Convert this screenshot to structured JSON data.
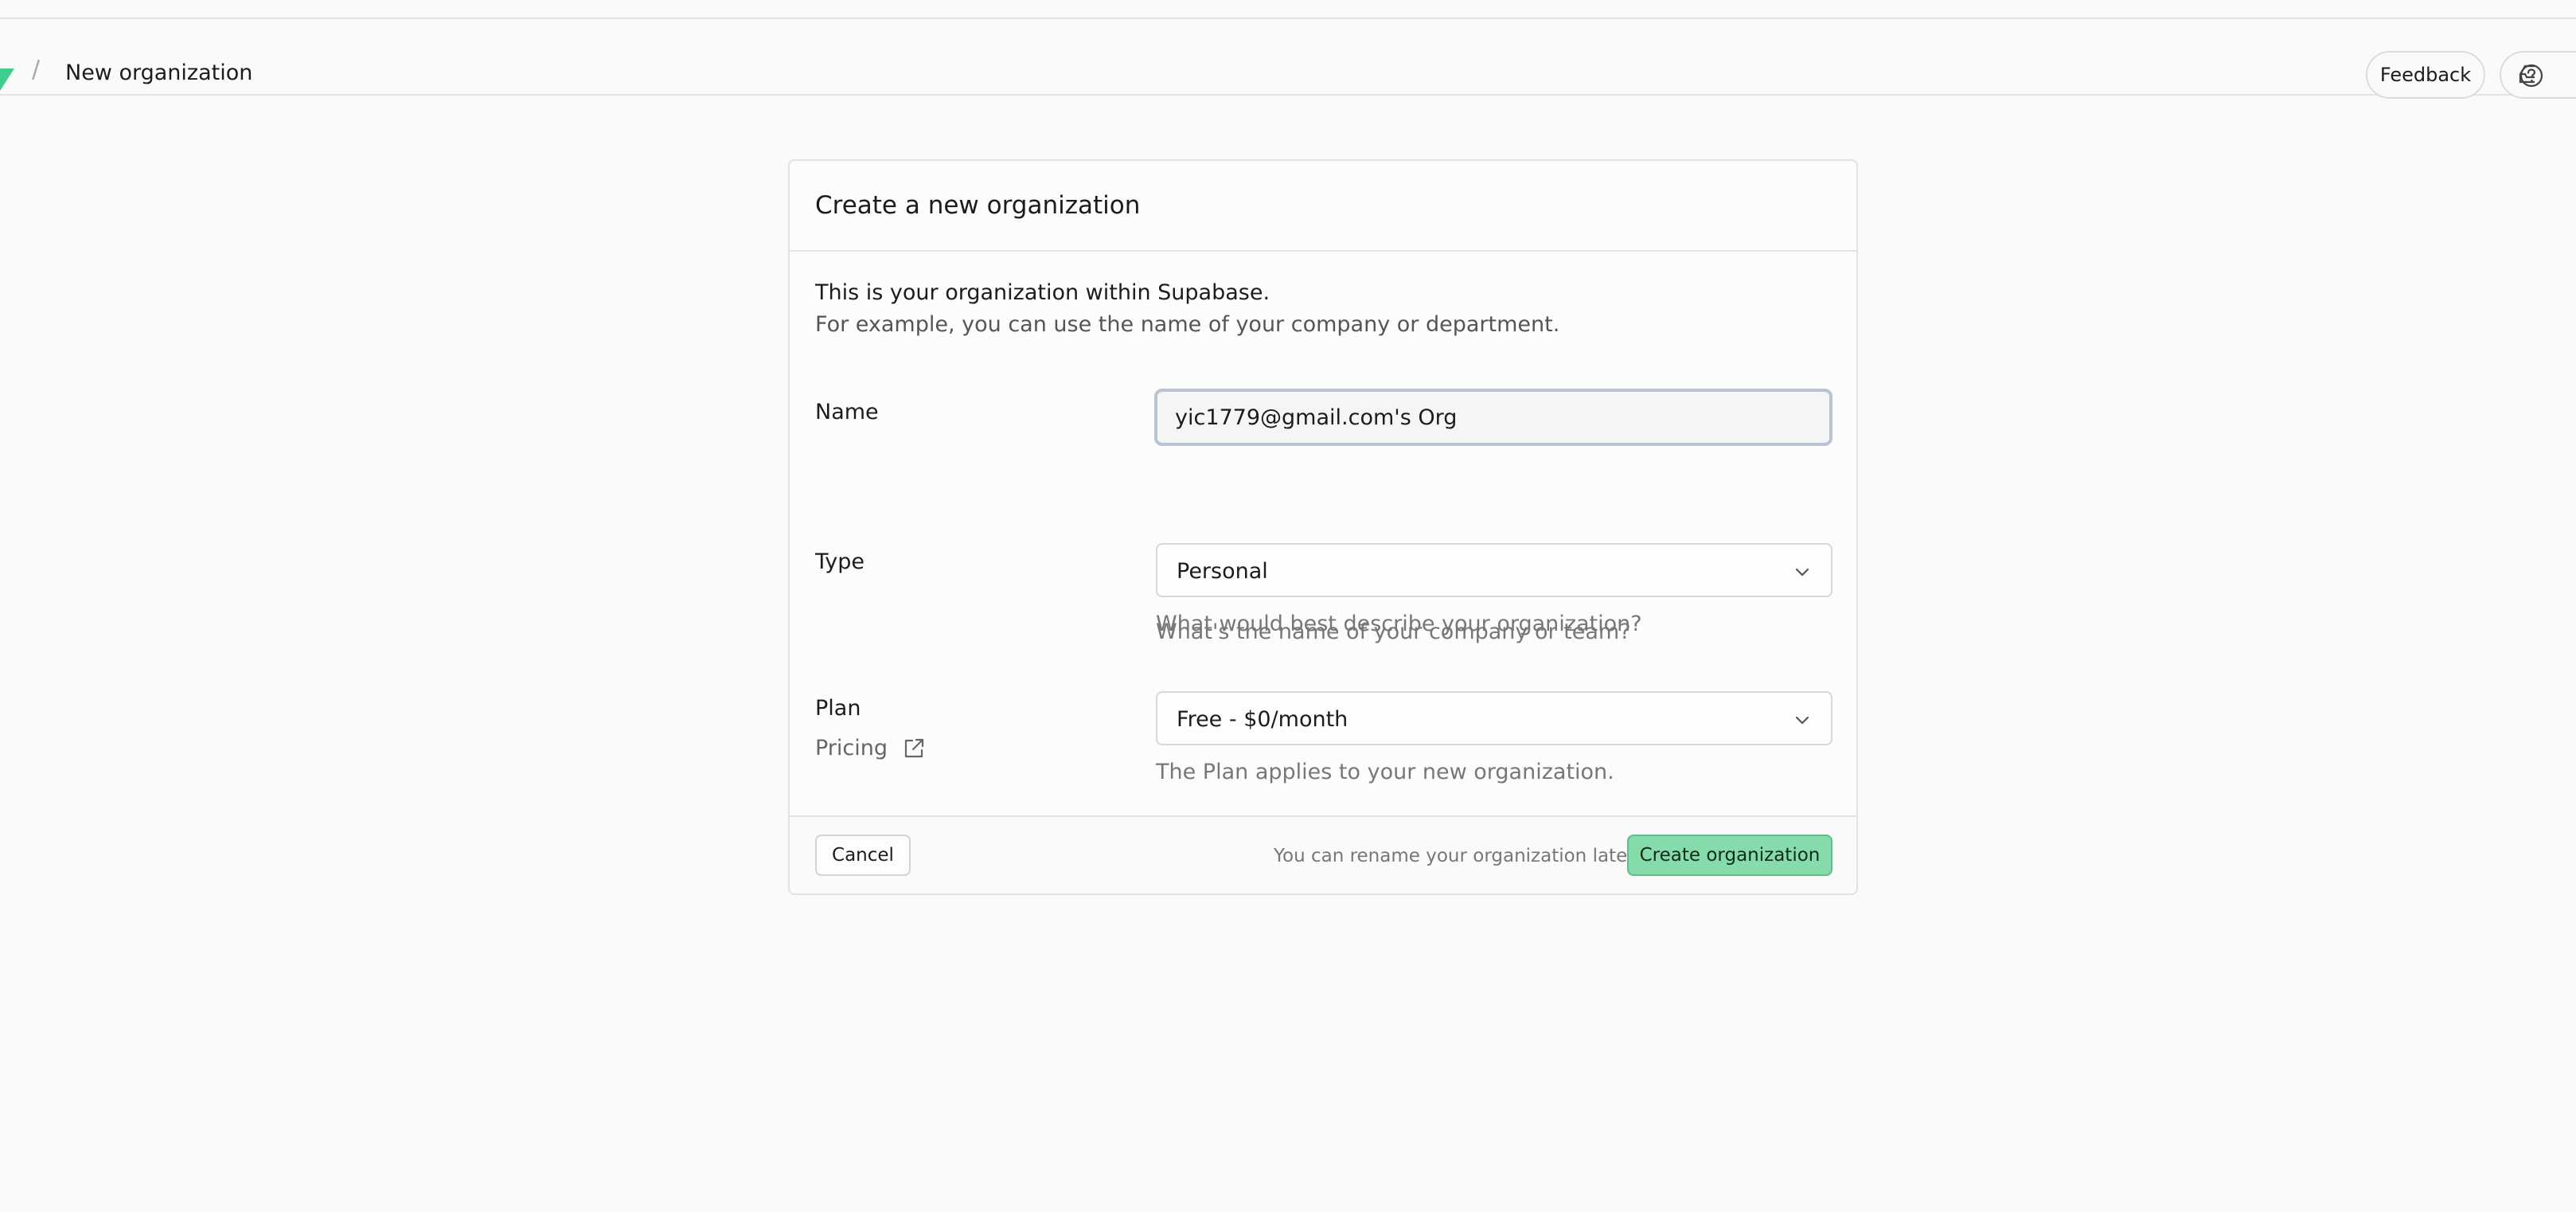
{
  "header": {
    "logo": "supabase-logo-icon",
    "separator": "/",
    "title": "New organization",
    "feedback_label": "Feedback",
    "help_icon": "help-circle-icon",
    "inbox_icon": "inbox-icon"
  },
  "card": {
    "title": "Create a new organization",
    "intro_line1": "This is your organization within Supabase.",
    "intro_line2": "For example, you can use the name of your company or department.",
    "name": {
      "label": "Name",
      "value": "yic1779@gmail.com's Org",
      "help": "What's the name of your company or team?"
    },
    "type": {
      "label": "Type",
      "selected": "Personal",
      "help": "What would best describe your organization?"
    },
    "plan": {
      "label": "Plan",
      "selected": "Free - $0/month",
      "help": "The Plan applies to your new organization.",
      "pricing_link": "Pricing",
      "pricing_icon": "external-link-icon"
    },
    "footer": {
      "cancel_label": "Cancel",
      "note": "You can rename your organization later",
      "create_label": "Create organization"
    }
  },
  "colors": {
    "accent": "#86dbab",
    "accent_border": "#5fbf8a",
    "logo_green": "#3ecf8e"
  }
}
